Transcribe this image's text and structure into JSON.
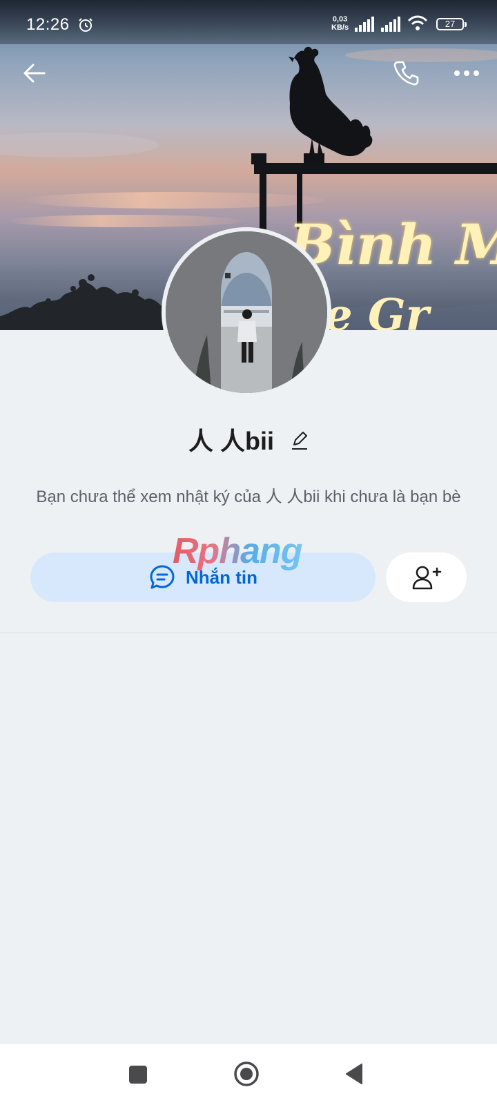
{
  "status_bar": {
    "time": "12:26",
    "net_speed_value": "0,03",
    "net_speed_unit": "KB/s",
    "battery": "27"
  },
  "top_bar": {
    "back_icon": "arrow-left-icon",
    "call_icon": "phone-icon",
    "more_icon": "more-horizontal-icon"
  },
  "cover": {
    "sign_text_line1": "Bình Minh"
  },
  "profile": {
    "name": "人 人bii",
    "edit_icon": "pencil-icon",
    "privacy_note": "Bạn chưa thể xem nhật ký của 人 人bii khi chưa là bạn bè"
  },
  "watermark": "Rphang",
  "actions": {
    "message_label": "Nhắn tin",
    "message_icon": "chat-bubble-icon",
    "add_friend_icon": "user-plus-icon"
  },
  "colors": {
    "primary": "#0068d6",
    "message_button_bg": "#d7e8fd",
    "page_bg": "#eef1f3"
  }
}
